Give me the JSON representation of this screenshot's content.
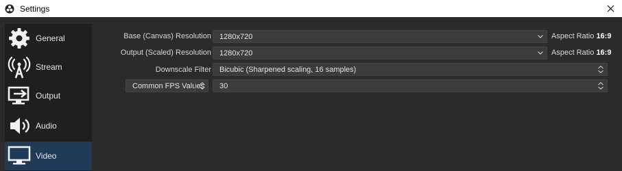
{
  "window": {
    "title": "Settings"
  },
  "sidebar": {
    "items": [
      {
        "label": "General",
        "icon": "gear-icon"
      },
      {
        "label": "Stream",
        "icon": "broadcast-icon"
      },
      {
        "label": "Output",
        "icon": "output-icon"
      },
      {
        "label": "Audio",
        "icon": "speaker-icon"
      },
      {
        "label": "Video",
        "icon": "monitor-icon",
        "active": true
      }
    ]
  },
  "video": {
    "base_resolution": {
      "label": "Base (Canvas) Resolution",
      "value": "1280x720",
      "aspect_prefix": "Aspect Ratio",
      "aspect_value": "16:9"
    },
    "output_resolution": {
      "label": "Output (Scaled) Resolution",
      "value": "1280x720",
      "aspect_prefix": "Aspect Ratio",
      "aspect_value": "16:9"
    },
    "downscale_filter": {
      "label": "Downscale Filter",
      "value": "Bicubic (Sharpened scaling, 16 samples)"
    },
    "fps": {
      "mode": "Common FPS Values",
      "value": "30"
    }
  },
  "colors": {
    "background": "#2b2b2b",
    "sidebar": "#1f1f1f",
    "active_item": "#1f3b57",
    "input": "#3c3c3c"
  }
}
